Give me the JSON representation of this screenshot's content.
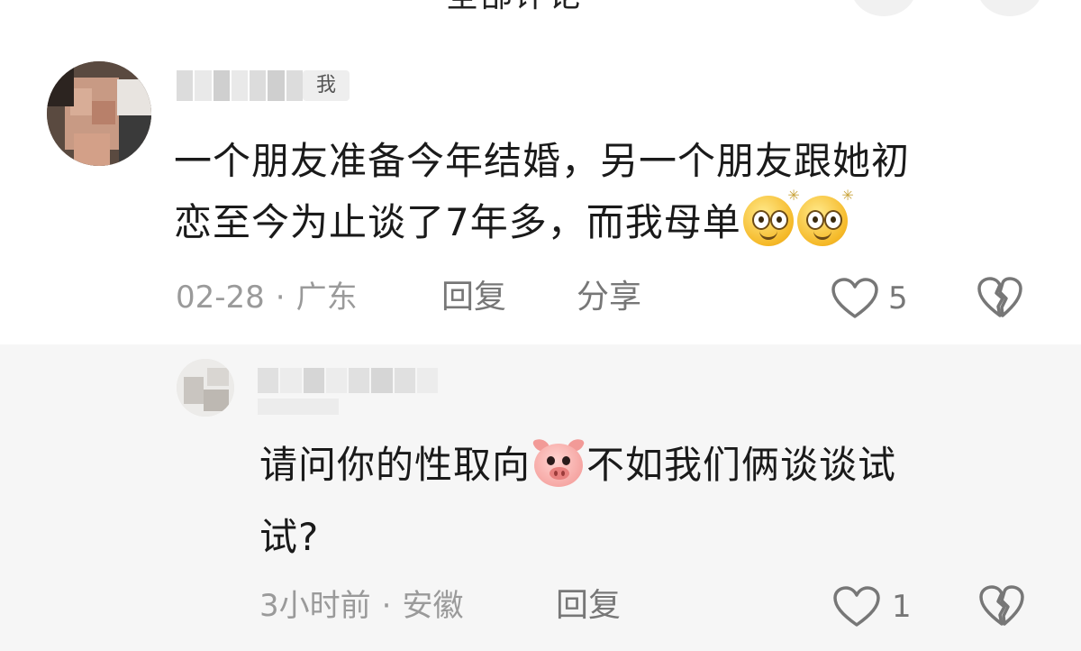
{
  "header": {
    "title_cut": "全部评论"
  },
  "comment": {
    "me_badge": "我",
    "text_line1": "一个朋友准备今年结婚，另一个朋友跟她初",
    "text_line2": "恋至今为止谈了7年多，而我母单",
    "emoji": "stare-emoji",
    "date": "02-28",
    "separator": "·",
    "location": "广东",
    "reply_label": "回复",
    "share_label": "分享",
    "like_count": "5"
  },
  "reply": {
    "text_part1": "请问你的性取向",
    "emoji": "pig-emoji",
    "text_part2": "不如我们俩谈谈试",
    "text_line2": "试?",
    "time": "3小时前",
    "separator": "·",
    "location": "安徽",
    "reply_label": "回复",
    "like_count": "1"
  },
  "colors": {
    "text": "#1a1a1a",
    "meta": "#9a9a9a",
    "reply_bg": "#f6f6f6"
  }
}
